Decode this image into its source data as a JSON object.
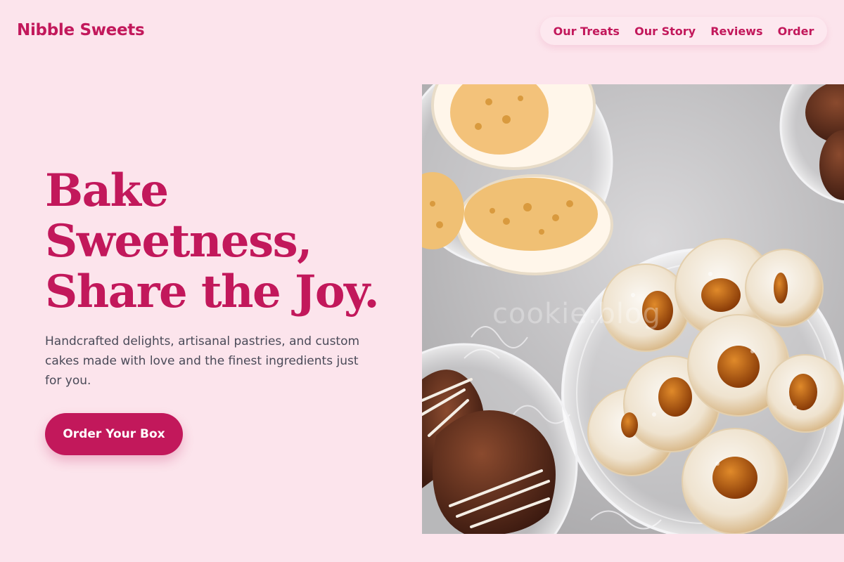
{
  "brand": {
    "name": "Nibble Sweets"
  },
  "nav": {
    "items": [
      {
        "label": "Our Treats"
      },
      {
        "label": "Our Story"
      },
      {
        "label": "Reviews"
      },
      {
        "label": "Order"
      }
    ]
  },
  "hero": {
    "title_lines": [
      "Bake",
      "Sweetness,",
      "Share the Joy."
    ],
    "subtitle": "Handcrafted delights, artisanal pastries, and custom cakes made with love and the finest ingredients just for you.",
    "cta_label": "Order Your Box"
  },
  "photo": {
    "watermark": "cookie.blog"
  },
  "colors": {
    "accent": "#c2185b",
    "background": "#fce4ec",
    "text": "#4a4a58"
  }
}
